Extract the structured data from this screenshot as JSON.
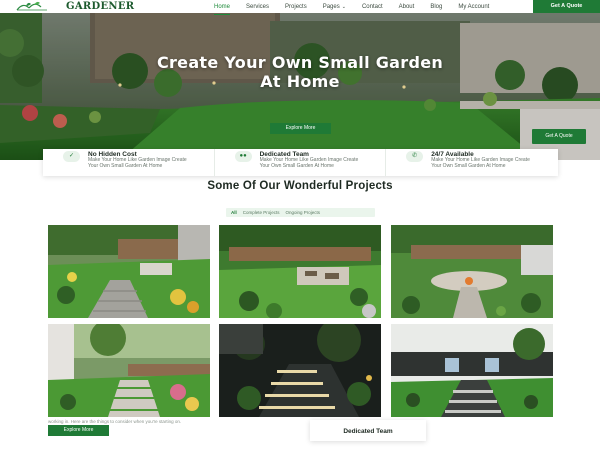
{
  "navbar": {
    "brand": "GARDENER",
    "logo_icon": "leaf-logo-icon",
    "items": [
      {
        "label": "Home",
        "active": true
      },
      {
        "label": "Services",
        "active": false
      },
      {
        "label": "Projects",
        "active": false
      },
      {
        "label": "Pages",
        "active": false,
        "caret": "chevron-down-icon"
      },
      {
        "label": "Contact",
        "active": false
      },
      {
        "label": "About",
        "active": false
      },
      {
        "label": "Blog",
        "active": false
      },
      {
        "label": "My Account",
        "active": false
      }
    ],
    "cta_label": "Get A Quote"
  },
  "hero": {
    "title": "Create Your Own Small Garden At Home",
    "button_label": "Explore More",
    "side_button_label": "Get A Quote"
  },
  "features": [
    {
      "icon": "check-icon",
      "title": "No Hidden Cost",
      "text": "Make Your Home Like Garden Image Create Your Own Small Garden At Home"
    },
    {
      "icon": "team-icon",
      "title": "Dedicated Team",
      "text": "Make Your Home Like Garden Image Create Your Own Small Garden At Home"
    },
    {
      "icon": "phone-icon",
      "title": "24/7 Available",
      "text": "Make Your Home Like Garden Image Create Your Own Small Garden At Home"
    }
  ],
  "projects": {
    "title": "Some Of Our Wonderful Projects",
    "filters": [
      {
        "label": "All",
        "active": true
      },
      {
        "label": "Complete Projects",
        "active": false
      },
      {
        "label": "Ongoing Projects",
        "active": false
      }
    ]
  },
  "bottom": {
    "caption": "working in. Here are the things to consider when you're starting on.",
    "button_label": "Explore More",
    "card_title": "Dedicated Team"
  },
  "colors": {
    "brand_green": "#1f7a36",
    "accent_green": "#1f8b3b",
    "filter_bg": "#eaf5ec"
  }
}
